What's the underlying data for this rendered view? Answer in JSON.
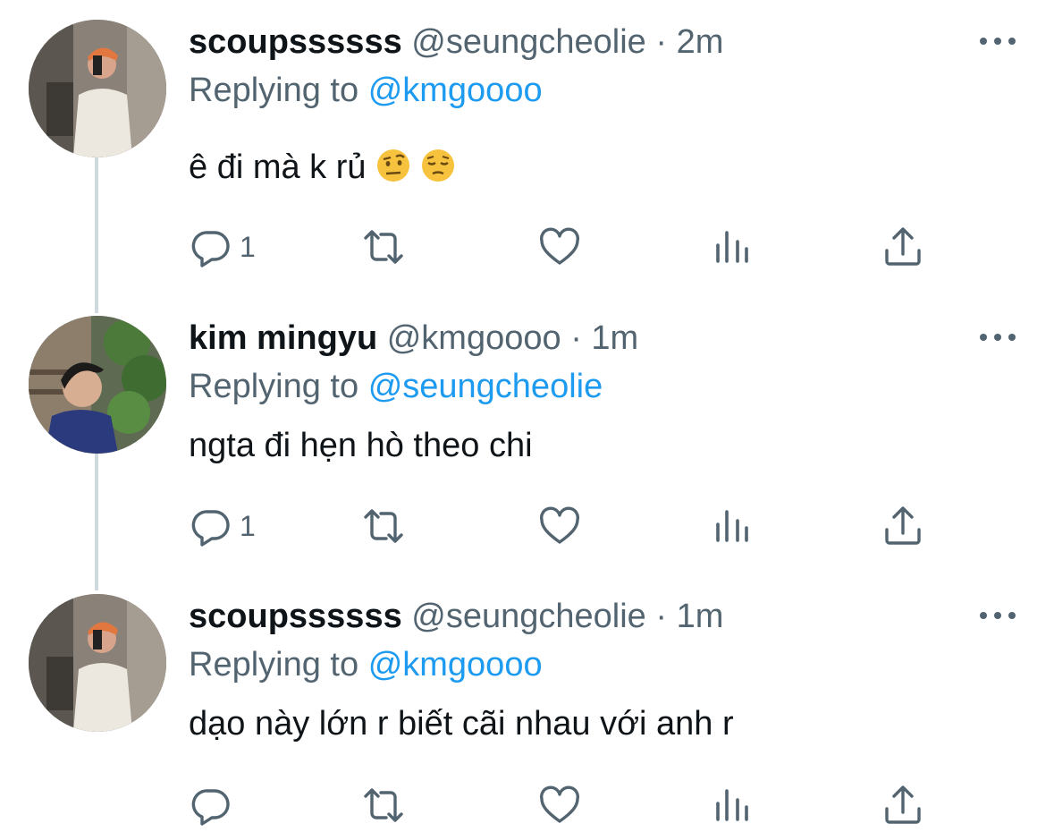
{
  "tweets": [
    {
      "display_name": "scoupssssss",
      "handle": "@seungcheolie",
      "separator": "·",
      "time": "2m",
      "replying_prefix": "Replying to",
      "replying_to": "@kmgoooo",
      "text": "ê đi mà k rủ",
      "emojis": [
        "face-with-raised-eyebrow",
        "pensive-face"
      ],
      "reply_count": "1",
      "avatar": "selfie-mirror-photo"
    },
    {
      "display_name": "kim mingyu",
      "handle": "@kmgoooo",
      "separator": "·",
      "time": "1m",
      "replying_prefix": "Replying to",
      "replying_to": "@seungcheolie",
      "text": "ngta đi hẹn hò theo chi",
      "reply_count": "1",
      "avatar": "outdoor-plants-photo"
    },
    {
      "display_name": "scoupssssss",
      "handle": "@seungcheolie",
      "separator": "·",
      "time": "1m",
      "replying_prefix": "Replying to",
      "replying_to": "@kmgoooo",
      "text": "dạo này lớn r biết cãi nhau với anh r",
      "reply_count": "",
      "avatar": "selfie-mirror-photo"
    }
  ],
  "colors": {
    "text": "#0f1419",
    "secondary": "#536471",
    "link": "#1d9bf0",
    "thread_line": "#cfd9de"
  },
  "icons": [
    "more-icon",
    "reply-icon",
    "retweet-icon",
    "like-icon",
    "analytics-icon",
    "share-icon"
  ]
}
